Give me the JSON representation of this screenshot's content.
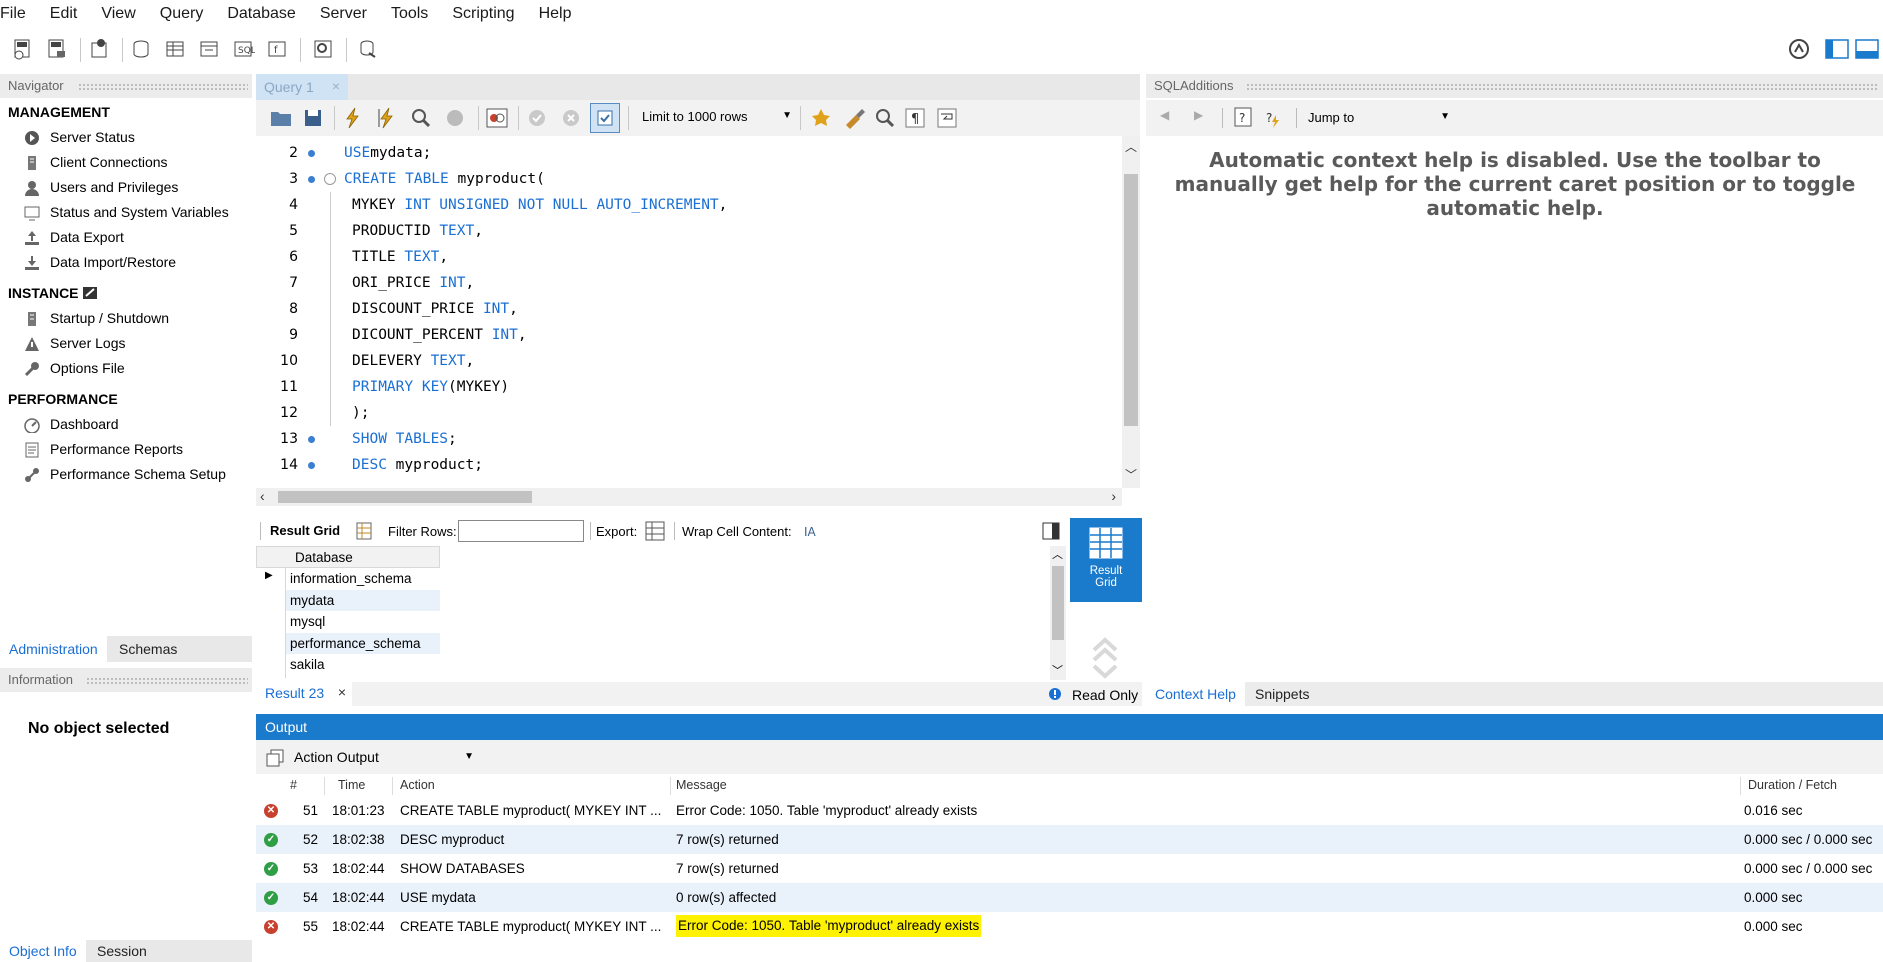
{
  "menu": [
    "File",
    "Edit",
    "View",
    "Query",
    "Database",
    "Server",
    "Tools",
    "Scripting",
    "Help"
  ],
  "navigator": {
    "title": "Navigator",
    "sections": [
      {
        "title": "MANAGEMENT",
        "items": [
          "Server Status",
          "Client Connections",
          "Users and Privileges",
          "Status and System Variables",
          "Data Export",
          "Data Import/Restore"
        ]
      },
      {
        "title": "INSTANCE",
        "items": [
          "Startup / Shutdown",
          "Server Logs",
          "Options File"
        ]
      },
      {
        "title": "PERFORMANCE",
        "items": [
          "Dashboard",
          "Performance Reports",
          "Performance Schema Setup"
        ]
      }
    ],
    "tabs": [
      "Administration",
      "Schemas"
    ]
  },
  "information": {
    "title": "Information",
    "empty_text": "No object selected",
    "tabs": [
      "Object Info",
      "Session"
    ]
  },
  "query_tab": {
    "label": "Query 1"
  },
  "query_toolbar": {
    "limit_label": "Limit to 1000 rows"
  },
  "editor": {
    "lines": [
      {
        "num": "2",
        "dot": true,
        "fold": false,
        "indent": "",
        "parts": [
          [
            "kw",
            "USE"
          ],
          [
            "",
            "mydata;"
          ]
        ]
      },
      {
        "num": "3",
        "dot": true,
        "fold": true,
        "indent": "",
        "parts": [
          [
            "kw",
            "CREATE TABLE"
          ],
          [
            "",
            " myproduct("
          ]
        ]
      },
      {
        "num": "4",
        "dot": false,
        "fold": false,
        "indent": " ",
        "parts": [
          [
            "",
            "MYKEY "
          ],
          [
            "kw",
            "INT UNSIGNED NOT NULL AUTO_INCREMENT"
          ],
          [
            "",
            ","
          ]
        ]
      },
      {
        "num": "5",
        "dot": false,
        "fold": false,
        "indent": " ",
        "parts": [
          [
            "",
            "PRODUCTID "
          ],
          [
            "kw",
            "TEXT"
          ],
          [
            "",
            ","
          ]
        ]
      },
      {
        "num": "6",
        "dot": false,
        "fold": false,
        "indent": " ",
        "parts": [
          [
            "",
            "TITLE "
          ],
          [
            "kw",
            "TEXT"
          ],
          [
            "",
            ","
          ]
        ]
      },
      {
        "num": "7",
        "dot": false,
        "fold": false,
        "indent": " ",
        "parts": [
          [
            "",
            "ORI_PRICE "
          ],
          [
            "kw",
            "INT"
          ],
          [
            "",
            ","
          ]
        ]
      },
      {
        "num": "8",
        "dot": false,
        "fold": false,
        "indent": " ",
        "parts": [
          [
            "",
            "DISCOUNT_PRICE "
          ],
          [
            "kw",
            "INT"
          ],
          [
            "",
            ","
          ]
        ]
      },
      {
        "num": "9",
        "dot": false,
        "fold": false,
        "indent": " ",
        "parts": [
          [
            "",
            "DICOUNT_PERCENT "
          ],
          [
            "kw",
            "INT"
          ],
          [
            "",
            ","
          ]
        ]
      },
      {
        "num": "10",
        "dot": false,
        "fold": false,
        "indent": " ",
        "parts": [
          [
            "",
            "DELEVERY "
          ],
          [
            "kw",
            "TEXT"
          ],
          [
            "",
            ","
          ]
        ]
      },
      {
        "num": "11",
        "dot": false,
        "fold": false,
        "indent": " ",
        "parts": [
          [
            "kw",
            "PRIMARY KEY"
          ],
          [
            "",
            "(MYKEY)"
          ]
        ]
      },
      {
        "num": "12",
        "dot": false,
        "fold": false,
        "indent": " ",
        "parts": [
          [
            "",
            ");"
          ]
        ]
      },
      {
        "num": "13",
        "dot": true,
        "fold": false,
        "indent": " ",
        "parts": [
          [
            "kw",
            "SHOW TABLES"
          ],
          [
            "",
            ";"
          ]
        ]
      },
      {
        "num": "14",
        "dot": true,
        "fold": false,
        "indent": " ",
        "parts": [
          [
            "kw",
            "DESC"
          ],
          [
            "",
            " myproduct;"
          ]
        ]
      }
    ]
  },
  "result_bar": {
    "result_grid_label": "Result Grid",
    "filter_label": "Filter Rows:",
    "export_label": "Export:",
    "wrap_label": "Wrap Cell Content:",
    "side_button": "Result Grid"
  },
  "result_grid": {
    "column": "Database",
    "rows": [
      "information_schema",
      "mydata",
      "mysql",
      "performance_schema",
      "sakila"
    ]
  },
  "result_tab": {
    "label": "Result 23",
    "read_only": "Read Only"
  },
  "sql_additions": {
    "title": "SQLAdditions",
    "jump_label": "Jump to",
    "help_text": "Automatic context help is disabled. Use the toolbar to manually get help for the current caret position or to toggle automatic help.",
    "tabs": [
      "Context Help",
      "Snippets"
    ]
  },
  "output": {
    "title": "Output",
    "selector": "Action Output",
    "columns": [
      "#",
      "Time",
      "Action",
      "Message",
      "Duration / Fetch"
    ],
    "rows": [
      {
        "status": "error",
        "num": "51",
        "time": "18:01:23",
        "action": "CREATE TABLE myproduct(  MYKEY INT ...",
        "message": "Error Code: 1050. Table 'myproduct' already exists",
        "duration": "0.016 sec",
        "highlight": false
      },
      {
        "status": "ok",
        "num": "52",
        "time": "18:02:38",
        "action": "DESC myproduct",
        "message": "7 row(s) returned",
        "duration": "0.000 sec / 0.000 sec",
        "highlight": false
      },
      {
        "status": "ok",
        "num": "53",
        "time": "18:02:44",
        "action": "SHOW DATABASES",
        "message": "7 row(s) returned",
        "duration": "0.000 sec / 0.000 sec",
        "highlight": false
      },
      {
        "status": "ok",
        "num": "54",
        "time": "18:02:44",
        "action": "USE mydata",
        "message": "0 row(s) affected",
        "duration": "0.000 sec",
        "highlight": false
      },
      {
        "status": "error",
        "num": "55",
        "time": "18:02:44",
        "action": "CREATE TABLE myproduct(  MYKEY INT ...",
        "message": "Error Code: 1050. Table 'myproduct' already exists",
        "duration": "0.000 sec",
        "highlight": true
      }
    ]
  },
  "colors": {
    "accent": "#1a7acb",
    "keyword": "#1a6fd4",
    "error": "#c8402e",
    "ok": "#2f9e44",
    "highlight": "#fff200"
  }
}
